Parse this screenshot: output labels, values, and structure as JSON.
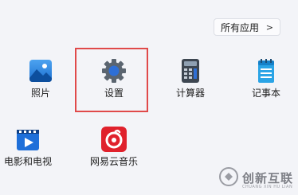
{
  "header": {
    "all_apps_label": "所有应用",
    "all_apps_chevron": ">"
  },
  "apps": [
    {
      "label": "照片",
      "icon": "photos-icon"
    },
    {
      "label": "设置",
      "icon": "gear-icon"
    },
    {
      "label": "计算器",
      "icon": "calculator-icon"
    },
    {
      "label": "记事本",
      "icon": "notepad-icon"
    },
    {
      "label": "电影和电视",
      "icon": "movies-tv-icon"
    },
    {
      "label": "网易云音乐",
      "icon": "netease-music-icon"
    }
  ],
  "watermark": {
    "text": "创新互联",
    "subtext": "CHUANG XIN HU LIAN"
  },
  "colors": {
    "highlight": "#e04a4a",
    "gear_blue": "#2e6fd6",
    "music_red": "#e0212c",
    "movies_blue": "#1e6fd9"
  }
}
